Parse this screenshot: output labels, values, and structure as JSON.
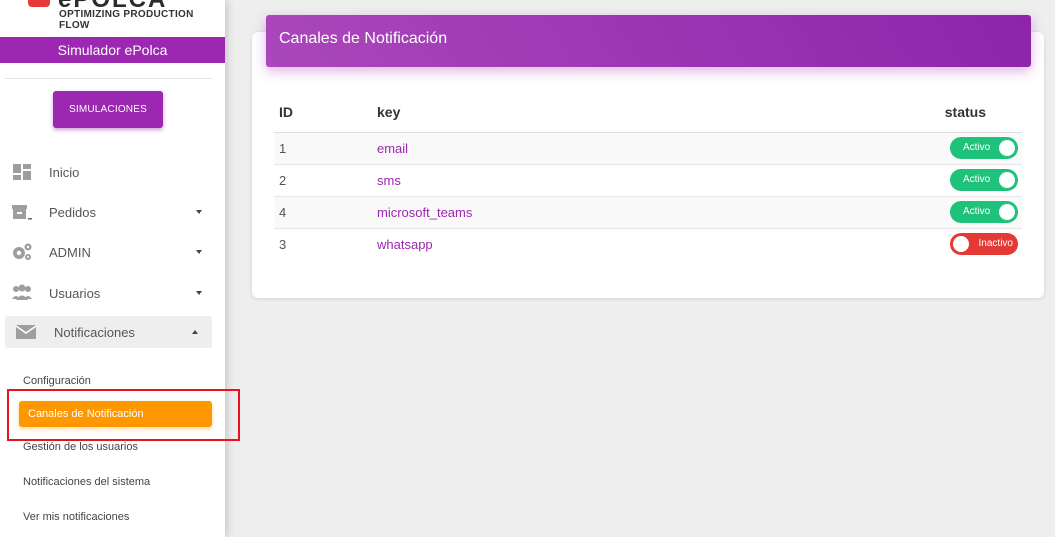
{
  "logo": {
    "wordmark": "ePOLCA",
    "tagline": "OPTIMIZING PRODUCTION FLOW"
  },
  "sidebar": {
    "brand": "Simulador ePolca",
    "simulate_button": "SIMULACIONES",
    "items": [
      {
        "label": "Inicio",
        "icon": "dashboard-icon"
      },
      {
        "label": "Pedidos",
        "icon": "archive-icon"
      },
      {
        "label": "ADMIN",
        "icon": "gears-icon"
      },
      {
        "label": "Usuarios",
        "icon": "users-icon"
      },
      {
        "label": "Notificaciones",
        "icon": "envelope-icon"
      }
    ],
    "subitems": [
      "Configuración",
      "Canales de Notificación",
      "Gestión de los usuarios",
      "Notificaciones del sistema",
      "Ver mis notificaciones"
    ],
    "active_subitem": "Canales de Notificación"
  },
  "card": {
    "title": "Canales de Notificación",
    "columns": [
      "ID",
      "key",
      "status"
    ],
    "rows": [
      {
        "id": "1",
        "key": "email",
        "status": "Activo",
        "active": true
      },
      {
        "id": "2",
        "key": "sms",
        "status": "Activo",
        "active": true
      },
      {
        "id": "4",
        "key": "microsoft_teams",
        "status": "Activo",
        "active": true
      },
      {
        "id": "3",
        "key": "whatsapp",
        "status": "Inactivo",
        "active": false
      }
    ]
  },
  "colors": {
    "primary": "#9c27b0",
    "active_nav": "#ff9800",
    "toggle_on": "#1ec27b",
    "toggle_off": "#e53935",
    "highlight_box": "#e8141b"
  }
}
